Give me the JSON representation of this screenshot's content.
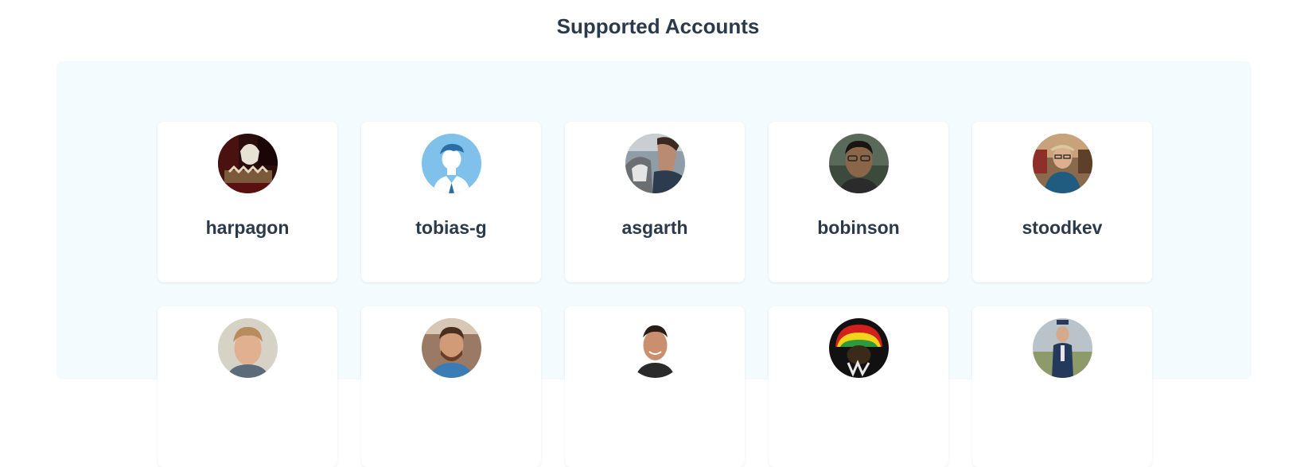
{
  "title": "Supported Accounts",
  "accounts": [
    {
      "username": "harpagon"
    },
    {
      "username": "tobias-g"
    },
    {
      "username": "asgarth"
    },
    {
      "username": "bobinson"
    },
    {
      "username": "stoodkev"
    },
    {
      "username": ""
    },
    {
      "username": ""
    },
    {
      "username": ""
    },
    {
      "username": ""
    },
    {
      "username": ""
    }
  ]
}
